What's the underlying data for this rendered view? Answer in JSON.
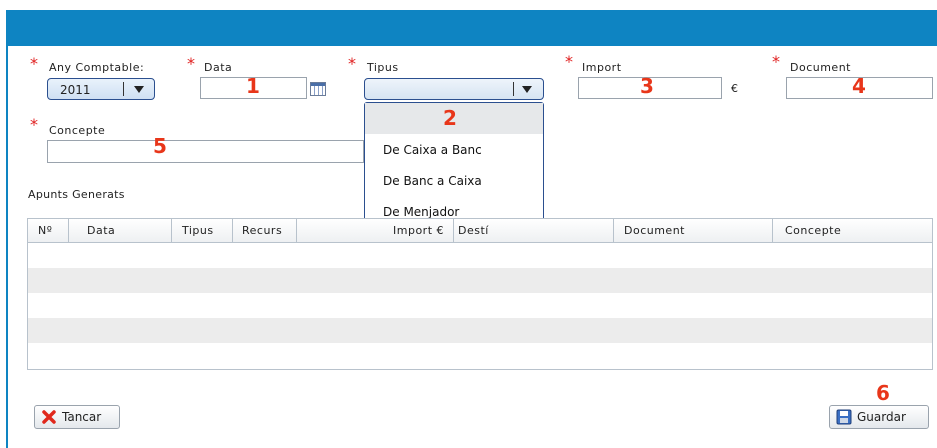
{
  "form": {
    "any_comptable": {
      "label": "Any Comptable:",
      "value": "2011",
      "required_mark": "*"
    },
    "data": {
      "label": "Data",
      "required_mark": "*",
      "value": ""
    },
    "tipus": {
      "label": "Tipus",
      "required_mark": "*",
      "value": "",
      "options": [
        "De Caixa a Banc",
        "De Banc a Caixa",
        "De Menjador"
      ]
    },
    "import": {
      "label": "Import",
      "required_mark": "*",
      "value": "",
      "unit": "€"
    },
    "document": {
      "label": "Document",
      "required_mark": "*",
      "value": ""
    },
    "concepte": {
      "label": "Concepte",
      "required_mark": "*",
      "value": ""
    }
  },
  "annotations": [
    "1",
    "2",
    "3",
    "4",
    "5",
    "6"
  ],
  "apunts": {
    "title": "Apunts Generats",
    "columns": [
      "Nº",
      "Data",
      "Tipus",
      "Recurs",
      "Import €",
      "Destí",
      "Document",
      "Concepte"
    ],
    "rows": []
  },
  "buttons": {
    "tancar": "Tancar",
    "guardar": "Guardar"
  },
  "colors": {
    "header": "#0e84c2",
    "annotation": "#e8361a",
    "required": "#e02020"
  }
}
